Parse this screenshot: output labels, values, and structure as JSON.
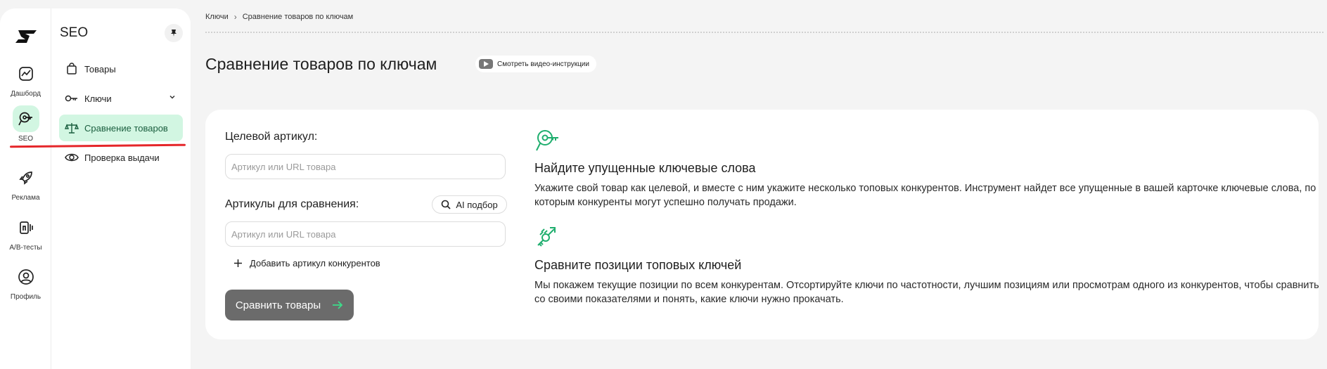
{
  "rail": {
    "items": [
      {
        "label": "Дашборд",
        "icon": "dashboard-icon"
      },
      {
        "label": "SEO",
        "icon": "seo-icon",
        "active": true
      },
      {
        "label": "Реклама",
        "icon": "rocket-icon"
      },
      {
        "label": "A/B-тесты",
        "icon": "ab-test-icon"
      },
      {
        "label": "Профиль",
        "icon": "profile-icon"
      }
    ]
  },
  "sidebar": {
    "title": "SEO",
    "items": [
      {
        "label": "Товары",
        "icon": "shopping-bag-icon"
      },
      {
        "label": "Ключи",
        "icon": "key-icon"
      },
      {
        "label": "Сравнение товаров",
        "icon": "scales-icon",
        "active": true
      },
      {
        "label": "Проверка выдачи",
        "icon": "eye-icon"
      }
    ]
  },
  "breadcrumb": {
    "items": [
      "Ключи",
      "Сравнение товаров по ключам"
    ]
  },
  "page": {
    "title": "Сравнение товаров по ключам",
    "video_button": "Смотреть видео-инструкции"
  },
  "form": {
    "target_label": "Целевой артикул:",
    "target_placeholder": "Артикул или URL товара",
    "compare_label": "Артикулы для сравнения:",
    "ai_button": "AI подбор",
    "compare_placeholder": "Артикул или URL товара",
    "add_link": "Добавить артикул конкурентов",
    "submit": "Сравнить товары"
  },
  "features": [
    {
      "title": "Найдите упущенные ключевые слова",
      "text": "Укажите свой товар как целевой, и вместе с ним укажите несколько топовых конкурентов. Инструмент найдет все упущенные в вашей карточке ключевые слова, по которым конкуренты могут успешно получать продажи."
    },
    {
      "title": "Сравните позиции топовых ключей",
      "text": "Мы покажем текущие позиции по всем конкурентам. Отсортируйте ключи по частотности, лучшим позициям или просмотрам одного из конкурентов, чтобы сравнить со своими показателями и понять, какие ключи нужно прокачать."
    }
  ],
  "colors": {
    "accent": "#1fae6e",
    "active_bg": "#d2f6e2",
    "button": "#6b6b6b",
    "highlight_line": "#e5262a"
  }
}
